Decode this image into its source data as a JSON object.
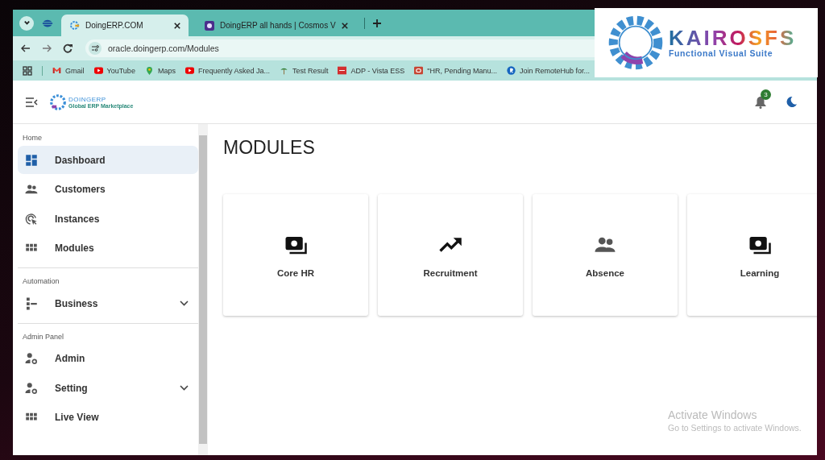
{
  "browser": {
    "tabs": [
      {
        "title": "DoingERP.COM",
        "kind": "erp",
        "selected": true
      },
      {
        "title": "DoingERP all hands | Cosmos V",
        "kind": "cosmos",
        "selected": false
      }
    ],
    "url": "oracle.doingerp.com/Modules",
    "bookmarks": [
      {
        "label": "Gmail",
        "kind": "gmail"
      },
      {
        "label": "YouTube",
        "kind": "youtube"
      },
      {
        "label": "Maps",
        "kind": "maps"
      },
      {
        "label": "Frequently Asked Ja...",
        "kind": "youtube"
      },
      {
        "label": "Test Result",
        "kind": "leaf"
      },
      {
        "label": "ADP - Vista ESS",
        "kind": "adp"
      },
      {
        "label": "\"HR, Pending Manu...",
        "kind": "oracle"
      },
      {
        "label": "Join RemoteHub for...",
        "kind": "remote"
      }
    ]
  },
  "app": {
    "logo": {
      "name": "DOINGERP",
      "tagline": "Global ERP Marketplace"
    },
    "notification_count": "3",
    "sidebar": [
      {
        "heading": "Home",
        "items": [
          {
            "label": "Dashboard",
            "kind": "dashboard",
            "selected": true,
            "expandable": false
          },
          {
            "label": "Customers",
            "kind": "people",
            "selected": false,
            "expandable": false
          },
          {
            "label": "Instances",
            "kind": "target",
            "selected": false,
            "expandable": false
          },
          {
            "label": "Modules",
            "kind": "grid",
            "selected": false,
            "expandable": false
          }
        ]
      },
      {
        "heading": "Automation",
        "items": [
          {
            "label": "Business",
            "kind": "tree",
            "selected": false,
            "expandable": true
          }
        ]
      },
      {
        "heading": "Admin Panel",
        "items": [
          {
            "label": "Admin",
            "kind": "usergear",
            "selected": false,
            "expandable": false
          },
          {
            "label": "Setting",
            "kind": "usergear",
            "selected": false,
            "expandable": true
          },
          {
            "label": "Live View",
            "kind": "grid",
            "selected": false,
            "expandable": false
          }
        ]
      }
    ],
    "title": "MODULES",
    "modules": [
      {
        "label": "Core HR",
        "kind": "payments"
      },
      {
        "label": "Recruitment",
        "kind": "trending"
      },
      {
        "label": "Absence",
        "kind": "people"
      },
      {
        "label": "Learning",
        "kind": "payments"
      }
    ]
  },
  "overlay_logo": {
    "brand": "KAIROSFS",
    "tagline": "Functional Visual Suite"
  },
  "os_notice": {
    "title": "Activate Windows",
    "message": "Go to Settings to activate Windows."
  }
}
